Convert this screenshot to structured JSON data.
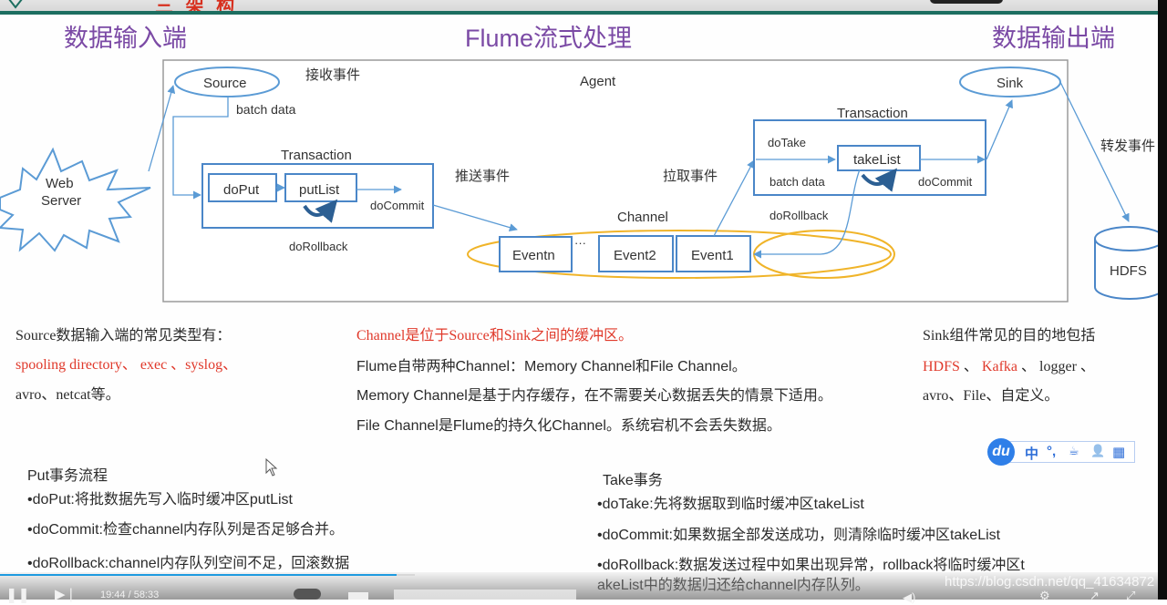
{
  "slide": {
    "top_title": "三 架 构",
    "headings": {
      "input": "数据输入端",
      "middle": "Flume流式处理",
      "output": "数据输出端"
    }
  },
  "diagram": {
    "agent_label": "Agent",
    "web_server": [
      "Web",
      "Server"
    ],
    "source": "Source",
    "receive_event": "接收事件",
    "batch_data_source": "batch data",
    "put_transaction": {
      "title": "Transaction",
      "do_put": "doPut",
      "put_list": "putList",
      "do_commit": "doCommit",
      "do_rollback": "doRollback"
    },
    "push_event": "推送事件",
    "pull_event": "拉取事件",
    "channel": {
      "label": "Channel",
      "events": [
        "Eventn",
        "Event2",
        "Event1"
      ],
      "ellipsis": "···"
    },
    "take_transaction": {
      "title": "Transaction",
      "do_take": "doTake",
      "take_list": "takeList",
      "batch_data": "batch data",
      "do_commit": "doCommit",
      "do_rollback": "doRollback"
    },
    "sink": "Sink",
    "forward_event": "转发事件",
    "hdfs": "HDFS",
    "colors": {
      "line": "#5b9bd5",
      "box": "#4a86c8",
      "channel_ellipse": "#f0b429"
    }
  },
  "notes": {
    "source": {
      "line1": "Source数据输入端的常见类型有：",
      "line2_red": "spooling directory、 exec 、syslog、",
      "line3": "avro、netcat等。"
    },
    "channel": {
      "line1_red": "Channel是位于Source和Sink之间的缓冲区。",
      "line2": "Flume自带两种Channel：Memory Channel和File Channel。",
      "line3": "Memory Channel是基于内存缓存，在不需要关心数据丢失的情景下适用。",
      "line4": "File Channel是Flume的持久化Channel。系统宕机不会丢失数据。"
    },
    "sink": {
      "line1": "Sink组件常见的目的地包括",
      "hdfs_red": "HDFS",
      "sep1": " 、 ",
      "kafka_red": "Kafka",
      "rest": " 、 logger 、",
      "line3": "avro、File、自定义。"
    },
    "put": {
      "title": "Put事务流程",
      "items": [
        "•doPut:将批数据先写入临时缓冲区putList",
        "•doCommit:检查channel内存队列是否足够合并。",
        "•doRollback:channel内存队列空间不足，回滚数据"
      ]
    },
    "take": {
      "title": "Take事务",
      "items": [
        "•doTake:先将数据取到临时缓冲区takeList",
        "•doCommit:如果数据全部发送成功，则清除临时缓冲区takeList",
        "•doRollback:数据发送过程中如果出现异常，rollback将临时缓冲区t",
        "akeList中的数据归还给channel内存队列。"
      ]
    }
  },
  "ime_toolbar": {
    "logo": "du",
    "items": [
      "中",
      "°,",
      "☕",
      "👤",
      "▦"
    ]
  },
  "player": {
    "progress_percent": 34,
    "time": "19:44 / 58:33",
    "watermark": "https://blog.csdn.net/qq_41634872"
  }
}
